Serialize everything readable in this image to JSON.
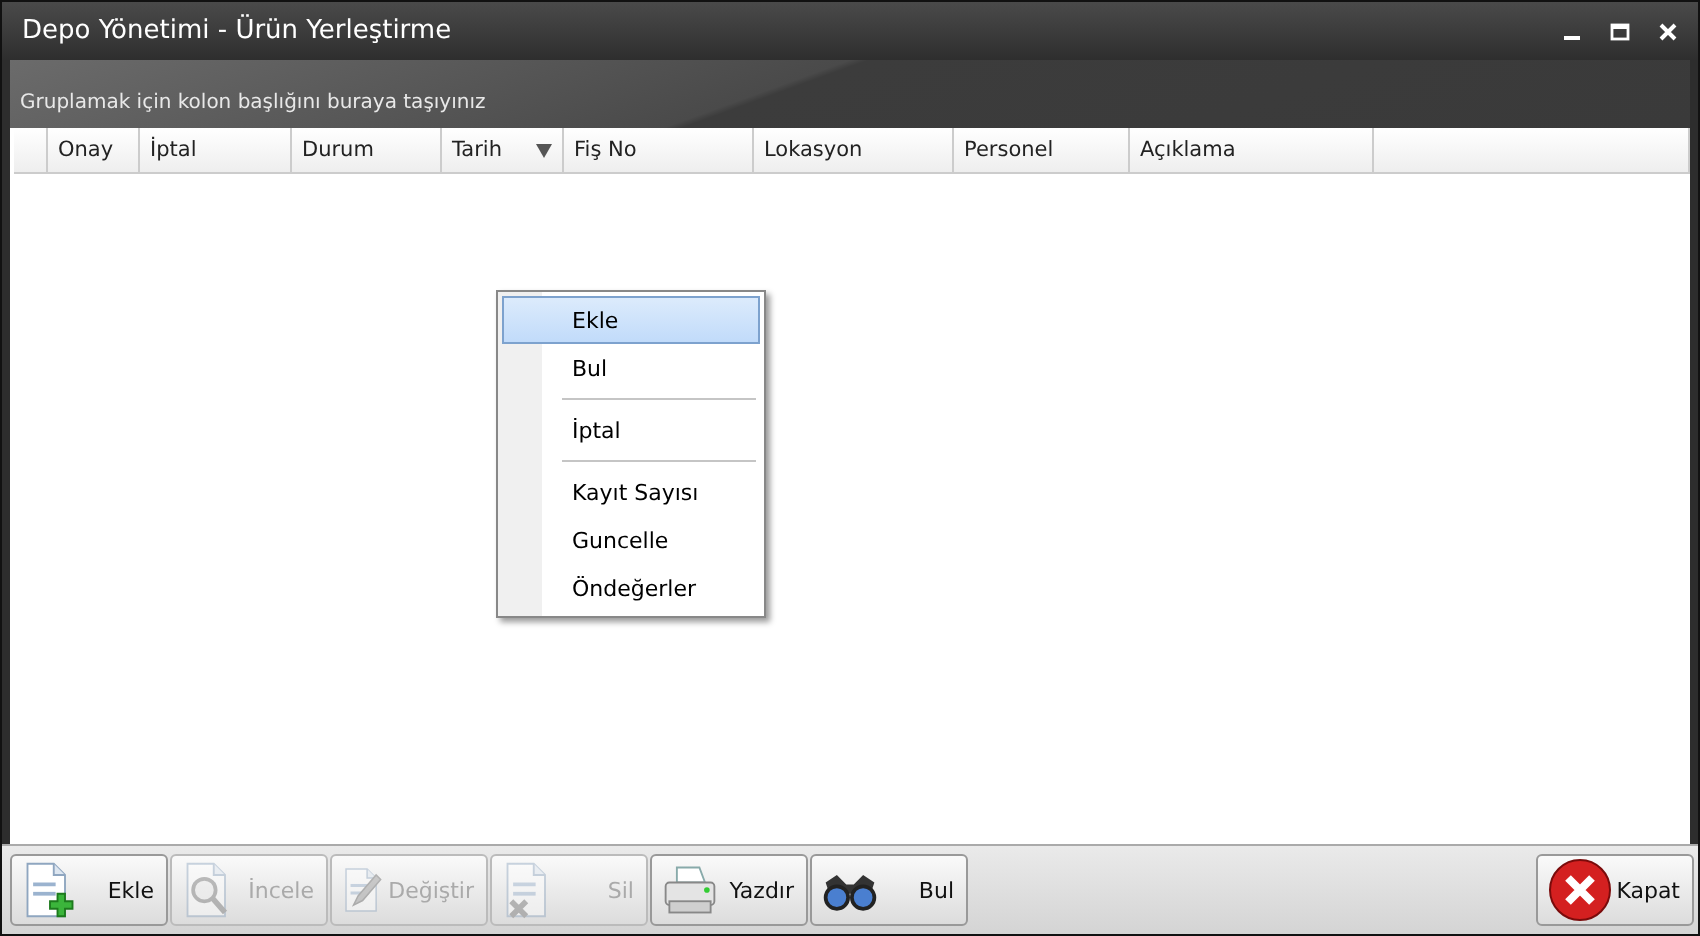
{
  "window": {
    "title": "Depo Yönetimi - Ürün Yerleştirme"
  },
  "group_panel": {
    "hint": "Gruplamak için kolon başlığını buraya taşıyınız"
  },
  "table": {
    "columns": [
      {
        "label": "Onay",
        "sorted": false
      },
      {
        "label": "İptal",
        "sorted": false
      },
      {
        "label": "Durum",
        "sorted": false
      },
      {
        "label": "Tarih",
        "sorted": true
      },
      {
        "label": "Fiş No",
        "sorted": false
      },
      {
        "label": "Lokasyon",
        "sorted": false
      },
      {
        "label": "Personel",
        "sorted": false
      },
      {
        "label": "Açıklama",
        "sorted": false
      }
    ]
  },
  "context_menu": {
    "items": [
      {
        "kind": "item",
        "label": "Ekle",
        "selected": true
      },
      {
        "kind": "item",
        "label": "Bul",
        "selected": false
      },
      {
        "kind": "separator"
      },
      {
        "kind": "item",
        "label": "İptal",
        "selected": false
      },
      {
        "kind": "separator"
      },
      {
        "kind": "item",
        "label": "Kayıt Sayısı",
        "selected": false
      },
      {
        "kind": "item",
        "label": "Guncelle",
        "selected": false
      },
      {
        "kind": "item",
        "label": "Öndeğerler",
        "selected": false
      }
    ]
  },
  "toolbar": {
    "buttons": [
      {
        "label": "Ekle",
        "disabled": false
      },
      {
        "label": "İncele",
        "disabled": true
      },
      {
        "label": "Değiştir",
        "disabled": true
      },
      {
        "label": "Sil",
        "disabled": true
      },
      {
        "label": "Yazdır",
        "disabled": false
      },
      {
        "label": "Bul",
        "disabled": false
      }
    ],
    "close_button": {
      "label": "Kapat"
    }
  }
}
